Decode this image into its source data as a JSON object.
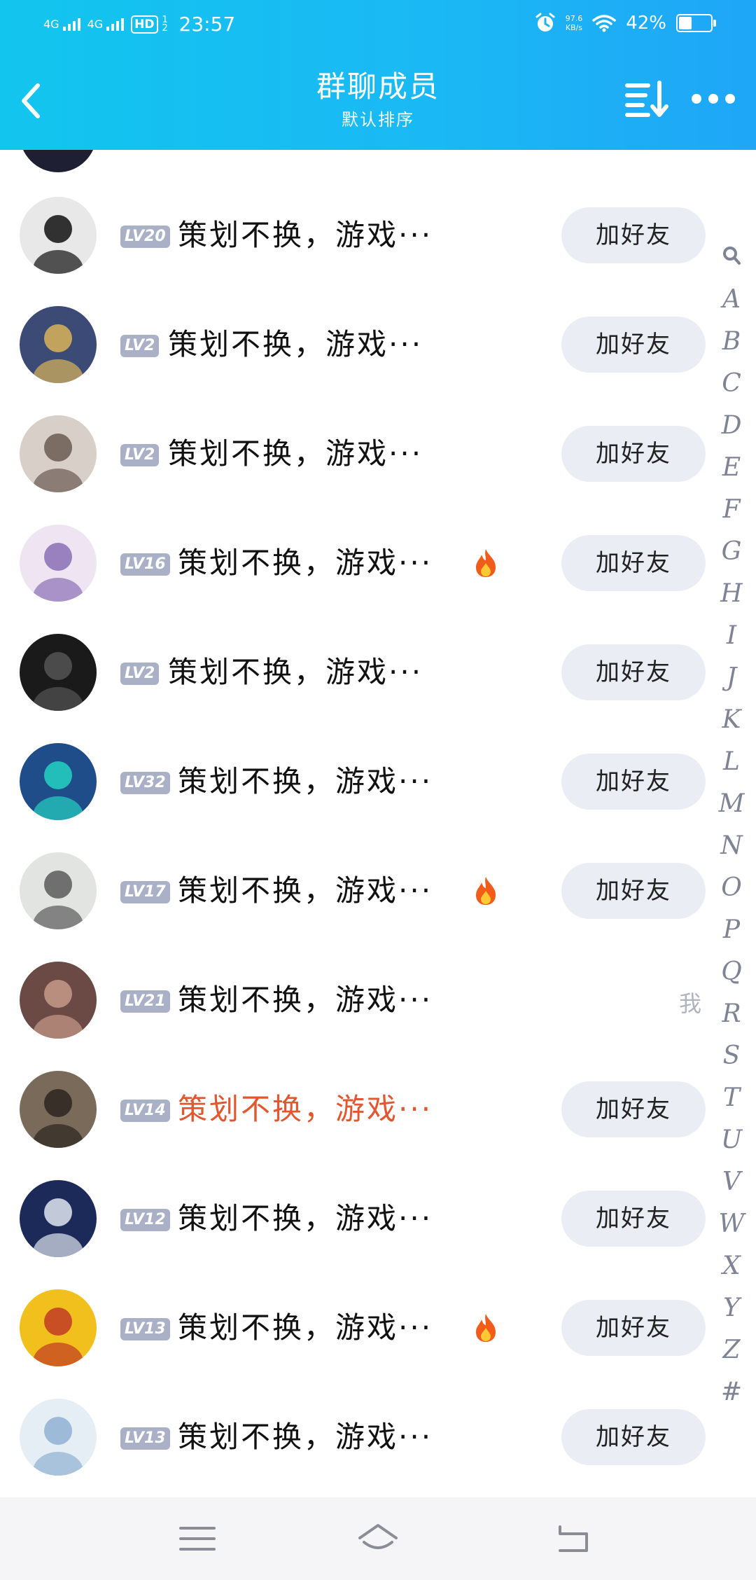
{
  "status_bar": {
    "signal1": "4G",
    "signal2": "4G",
    "hd": "HD",
    "hd_sub": "1 2",
    "time": "23:57",
    "net_speed": "97.6",
    "net_unit": "KB/s",
    "battery": "42%",
    "battery_level": 0.42
  },
  "nav": {
    "title": "群聊成员",
    "subtitle": "默认排序"
  },
  "members": [
    {
      "level": "LV20",
      "name": "策划不换，游戏···",
      "action": "加好友",
      "fire": false,
      "red": false,
      "avatar_color": "#e8e8e8",
      "avatar_accent": "#111111"
    },
    {
      "level": "LV2",
      "name": "策划不换，游戏···",
      "action": "加好友",
      "fire": false,
      "red": false,
      "avatar_color": "#3c4b76",
      "avatar_accent": "#d9b35a"
    },
    {
      "level": "LV2",
      "name": "策划不换，游戏···",
      "action": "加好友",
      "fire": false,
      "red": false,
      "avatar_color": "#d8cfc8",
      "avatar_accent": "#6b5a52"
    },
    {
      "level": "LV16",
      "name": "策划不换，游戏···",
      "action": "加好友",
      "fire": true,
      "red": false,
      "avatar_color": "#efe5f2",
      "avatar_accent": "#8a6fb5"
    },
    {
      "level": "LV2",
      "name": "策划不换，游戏···",
      "action": "加好友",
      "fire": false,
      "red": false,
      "avatar_color": "#1a1a1a",
      "avatar_accent": "#555555"
    },
    {
      "level": "LV32",
      "name": "策划不换，游戏···",
      "action": "加好友",
      "fire": false,
      "red": false,
      "avatar_color": "#1f4d8a",
      "avatar_accent": "#25d2c2"
    },
    {
      "level": "LV17",
      "name": "策划不换，游戏···",
      "action": "加好友",
      "fire": true,
      "red": false,
      "avatar_color": "#e2e4e2",
      "avatar_accent": "#5a5a5a"
    },
    {
      "level": "LV21",
      "name": "策划不换，游戏···",
      "action": "",
      "me": "我",
      "fire": false,
      "red": false,
      "avatar_color": "#6b4a45",
      "avatar_accent": "#c79a8a"
    },
    {
      "level": "LV14",
      "name": "策划不换，游戏···",
      "action": "加好友",
      "fire": false,
      "red": true,
      "avatar_color": "#7a6a5a",
      "avatar_accent": "#2b2520"
    },
    {
      "level": "LV12",
      "name": "策划不换，游戏···",
      "action": "加好友",
      "fire": false,
      "red": false,
      "avatar_color": "#1c2a5a",
      "avatar_accent": "#dfe6f0"
    },
    {
      "level": "LV13",
      "name": "策划不换，游戏···",
      "action": "加好友",
      "fire": true,
      "red": false,
      "avatar_color": "#f2c01c",
      "avatar_accent": "#c13b24"
    },
    {
      "level": "LV13",
      "name": "策划不换，游戏···",
      "action": "加好友",
      "fire": false,
      "red": false,
      "avatar_color": "#e6eef5",
      "avatar_accent": "#8fb0d2"
    }
  ],
  "index_letters": [
    "A",
    "B",
    "C",
    "D",
    "E",
    "F",
    "G",
    "H",
    "I",
    "J",
    "K",
    "L",
    "M",
    "N",
    "O",
    "P",
    "Q",
    "R",
    "S",
    "T",
    "U",
    "V",
    "W",
    "X",
    "Y",
    "Z",
    "#"
  ],
  "icons": {
    "back": "chevron-left-icon",
    "sort": "sort-icon",
    "more": "more-icon",
    "index_search": "search-icon",
    "fire": "fire-icon",
    "nav_menu": "menu-icon",
    "nav_home": "home-icon",
    "nav_back": "back-icon"
  },
  "colors": {
    "header_start": "#12c5ee",
    "header_end": "#1fa6f7",
    "level_badge": "#aab0c6",
    "button_bg": "#ebedf5",
    "highlight_name": "#e1572f"
  }
}
